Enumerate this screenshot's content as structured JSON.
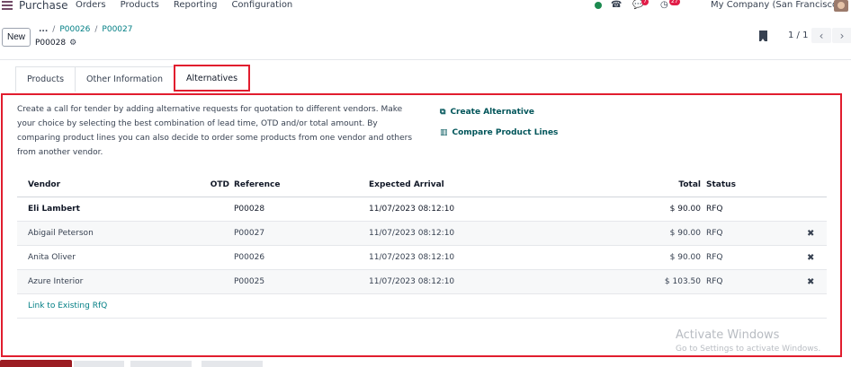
{
  "navbar": {
    "app_name": "Purchase",
    "menu": [
      "Orders",
      "Products",
      "Reporting",
      "Configuration"
    ],
    "chat_badge": "7",
    "activity_badge": "27",
    "company": "My Company (San Francisco)"
  },
  "control": {
    "new_label": "New",
    "breadcrumb_more": "...",
    "breadcrumb_1": "P00026",
    "breadcrumb_2": "P00027",
    "sep": "/",
    "record": "P00028",
    "pager": "1 / 1"
  },
  "tabs": [
    {
      "label": "Products"
    },
    {
      "label": "Other Information"
    },
    {
      "label": "Alternatives"
    }
  ],
  "alternatives": {
    "description": "Create a call for tender by adding alternative requests for quotation to different vendors. Make your choice by selecting the best combination of lead time, OTD and/or total amount. By comparing product lines you can also decide to order some products from one vendor and others from another vendor.",
    "create_label": "Create Alternative",
    "compare_label": "Compare Product Lines",
    "headers": {
      "vendor": "Vendor",
      "otd": "OTD",
      "reference": "Reference",
      "arrival": "Expected Arrival",
      "total": "Total",
      "status": "Status"
    },
    "rows": [
      {
        "vendor": "Eli Lambert",
        "reference": "P00028",
        "arrival": "11/07/2023 08:12:10",
        "total": "$ 90.00",
        "status": "RFQ"
      },
      {
        "vendor": "Abigail Peterson",
        "reference": "P00027",
        "arrival": "11/07/2023 08:12:10",
        "total": "$ 90.00",
        "status": "RFQ"
      },
      {
        "vendor": "Anita Oliver",
        "reference": "P00026",
        "arrival": "11/07/2023 08:12:10",
        "total": "$ 90.00",
        "status": "RFQ"
      },
      {
        "vendor": "Azure Interior",
        "reference": "P00025",
        "arrival": "11/07/2023 08:12:10",
        "total": "$ 103.50",
        "status": "RFQ"
      }
    ],
    "link_existing": "Link to Existing RfQ"
  },
  "watermark": {
    "title": "Activate Windows",
    "subtitle": "Go to Settings to activate Windows."
  },
  "colors": {
    "accent": "#017e84",
    "highlight_border": "#e11d2e",
    "brand": "#714b67"
  }
}
